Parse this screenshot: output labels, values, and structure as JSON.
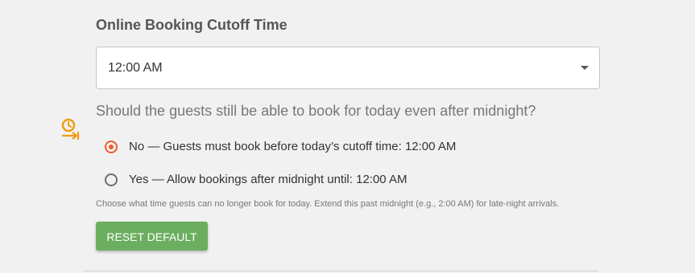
{
  "section": {
    "title": "Online Booking Cutoff Time"
  },
  "cutoff_select": {
    "value": "12:00 AM"
  },
  "after_midnight": {
    "question": "Should the guests still be able to book for today even after midnight?",
    "options": [
      {
        "label": "No — Guests must book before today’s cutoff time: 12:00 AM",
        "checked": true
      },
      {
        "label": "Yes — Allow bookings after midnight until: 12:00 AM",
        "checked": false
      }
    ],
    "hint": "Choose what time guests can no longer book for today. Extend this past midnight (e.g., 2:00 AM) for late-night arrivals."
  },
  "actions": {
    "reset_label": "RESET DEFAULT"
  },
  "colors": {
    "accent": "#ef5a2f",
    "icon": "#f39c12",
    "button": "#6cae5f"
  },
  "icons": {
    "side": "clock-arrow-icon"
  }
}
